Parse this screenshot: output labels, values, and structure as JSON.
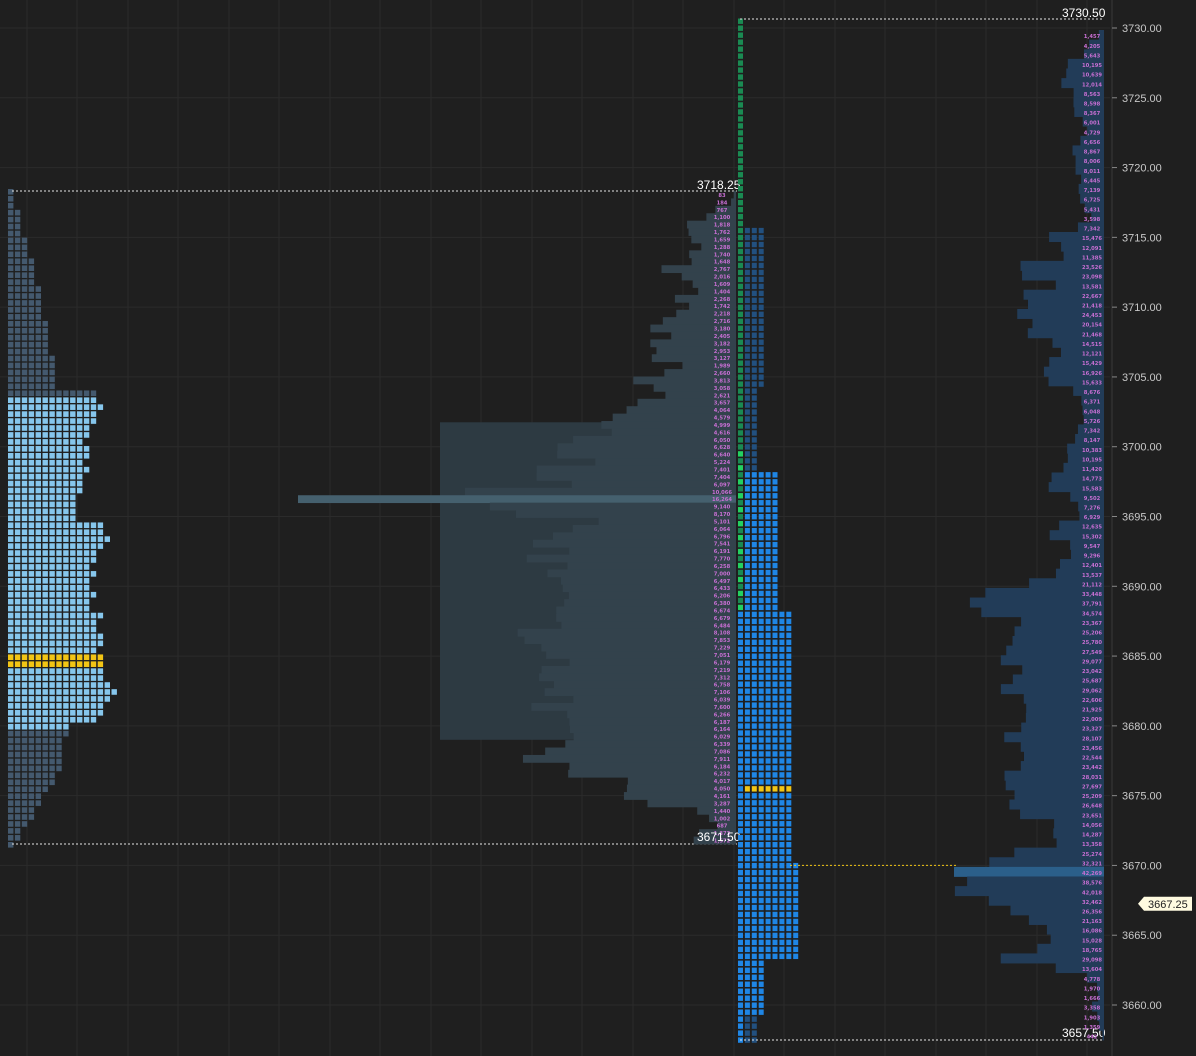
{
  "theme": {
    "background": "#1f1f1f",
    "grid": "#2b2b2b",
    "axis_text": "#c8c8c8",
    "tpo_outer": "#44596e",
    "tpo_value_area": "#86c6ec",
    "poc": "#f2c515",
    "volume_profile_fill": "#33424c",
    "volume_profile_value_area": "#3a4a54",
    "volume_poc": "#45606e",
    "green_column": "#1a8a52",
    "green_bright": "#23d160",
    "blue_tpo": "#1f86e5",
    "dark_tpo": "#22507f",
    "delta_profile": "#223c58",
    "delta_poc": "#2b5f8a",
    "volume_labels": "#c86fd4",
    "price_tag_bg": "#fffbe0"
  },
  "levels": {
    "high_left": "3718.25",
    "low_left": "3671.50",
    "high_right": "3730.50",
    "low_right": "3657.50",
    "current_price": "3667.25"
  },
  "chart_data": {
    "type": "volume_profile",
    "y_axis": {
      "ylim": [
        3657.25,
        3731.25
      ],
      "tick_step": 5,
      "ticks": [
        "3730.00",
        "3725.00",
        "3720.00",
        "3715.00",
        "3710.00",
        "3705.00",
        "3700.00",
        "3695.00",
        "3690.00",
        "3685.00",
        "3680.00",
        "3675.00",
        "3670.00",
        "3665.00",
        "3660.00"
      ]
    },
    "volume_labels": [
      "83",
      "184",
      "767",
      "1,100",
      "1,818",
      "1,762",
      "1,659",
      "1,288",
      "1,740",
      "1,648",
      "2,767",
      "2,016",
      "1,609",
      "1,404",
      "2,268",
      "1,742",
      "2,218",
      "2,716",
      "3,180",
      "2,405",
      "3,182",
      "2,953",
      "3,127",
      "1,989",
      "2,660",
      "3,813",
      "3,058",
      "2,621",
      "3,657",
      "4,064",
      "4,579",
      "4,999",
      "4,616",
      "6,050",
      "6,628",
      "6,640",
      "5,224",
      "7,401",
      "7,404",
      "6,097",
      "10,066",
      "16,264",
      "9,140",
      "8,170",
      "5,101",
      "6,064",
      "6,796",
      "7,541",
      "6,191",
      "7,770",
      "6,258",
      "7,000",
      "6,497",
      "6,433",
      "6,206",
      "6,380",
      "6,674",
      "6,679",
      "6,484",
      "8,108",
      "7,853",
      "7,229",
      "7,051",
      "6,179",
      "7,219",
      "7,312",
      "6,758",
      "7,106",
      "6,039",
      "7,600",
      "6,266",
      "6,187",
      "6,164",
      "6,029",
      "6,339",
      "7,086",
      "7,911",
      "6,184",
      "6,232",
      "4,017",
      "4,050",
      "4,161",
      "3,287",
      "1,440",
      "1,002",
      "687",
      "1,373",
      "1,572"
    ],
    "right_volume_labels": [
      "1,457",
      "4,205",
      "5,643",
      "10,195",
      "10,639",
      "12,014",
      "8,563",
      "8,598",
      "8,367",
      "6,001",
      "4,729",
      "6,656",
      "8,867",
      "8,006",
      "8,011",
      "6,445",
      "7,139",
      "6,725",
      "5,431",
      "3,598",
      "7,342",
      "15,476",
      "12,091",
      "11,385",
      "23,526",
      "23,098",
      "13,581",
      "22,667",
      "21,418",
      "24,453",
      "20,154",
      "21,468",
      "14,515",
      "12,121",
      "15,429",
      "16,926",
      "15,633",
      "8,676",
      "6,371",
      "6,048",
      "5,726",
      "7,342",
      "8,147",
      "10,383",
      "10,195",
      "11,420",
      "14,773",
      "15,583",
      "9,502",
      "7,276",
      "6,929",
      "12,635",
      "15,302",
      "9,547",
      "9,296",
      "12,401",
      "13,537",
      "21,112",
      "33,448",
      "37,791",
      "34,574",
      "23,367",
      "25,206",
      "25,780",
      "27,549",
      "29,077",
      "23,042",
      "25,687",
      "29,062",
      "22,606",
      "21,925",
      "22,009",
      "23,327",
      "28,107",
      "23,456",
      "22,544",
      "23,442",
      "28,031",
      "27,697",
      "25,209",
      "26,648",
      "23,651",
      "14,056",
      "14,287",
      "13,358",
      "25,274",
      "32,321",
      "42,269",
      "38,576",
      "42,018",
      "32,462",
      "26,356",
      "21,163",
      "16,086",
      "15,028",
      "18,765",
      "29,098",
      "13,604",
      "4,778",
      "1,970",
      "1,666",
      "3,358",
      "1,903",
      "1,359",
      "442"
    ]
  }
}
